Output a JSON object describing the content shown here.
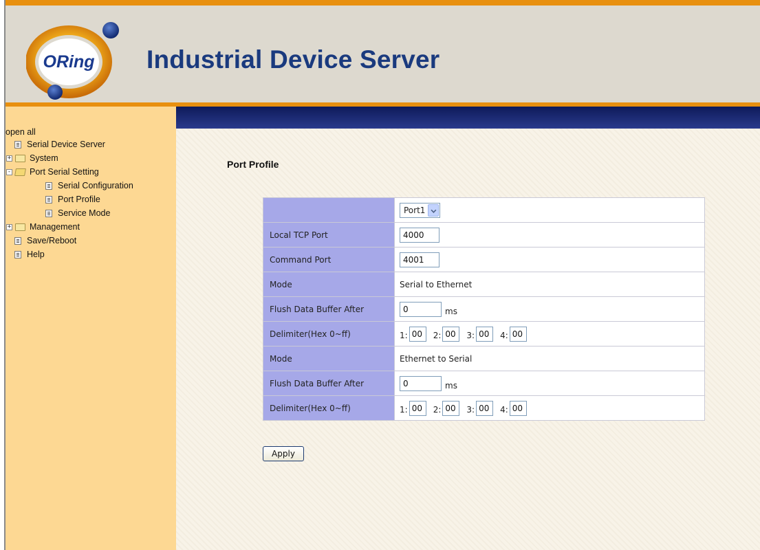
{
  "header": {
    "logo_text": "ORing",
    "title": "Industrial Device Server"
  },
  "sidebar": {
    "open_all": "open all",
    "items": [
      {
        "label": "Serial Device Server",
        "icon": "document-icon"
      },
      {
        "label": "System",
        "icon": "folder-icon",
        "toggle": "+"
      },
      {
        "label": "Port Serial Setting",
        "icon": "folder-open-icon",
        "toggle": "-"
      },
      {
        "label": "Serial Configuration",
        "icon": "document-icon"
      },
      {
        "label": "Port Profile",
        "icon": "document-icon"
      },
      {
        "label": "Service Mode",
        "icon": "document-icon"
      },
      {
        "label": "Management",
        "icon": "folder-icon",
        "toggle": "+"
      },
      {
        "label": "Save/Reboot",
        "icon": "document-icon"
      },
      {
        "label": "Help",
        "icon": "document-icon"
      }
    ]
  },
  "main": {
    "title": "Port Profile",
    "port_select": {
      "selected": "Port1"
    },
    "rows": {
      "local_tcp_port": {
        "label": "Local TCP Port",
        "value": "4000"
      },
      "command_port": {
        "label": "Command Port",
        "value": "4001"
      },
      "mode1": {
        "label": "Mode",
        "value": "Serial to Ethernet"
      },
      "flush1": {
        "label": "Flush Data Buffer After",
        "value": "0",
        "unit": "ms"
      },
      "delim1": {
        "label": "Delimiter(Hex 0~ff)",
        "l1": "1:",
        "l2": "2:",
        "l3": "3:",
        "l4": "4:",
        "v1": "00",
        "v2": "00",
        "v3": "00",
        "v4": "00"
      },
      "mode2": {
        "label": "Mode",
        "value": "Ethernet to Serial"
      },
      "flush2": {
        "label": "Flush Data Buffer After",
        "value": "0",
        "unit": "ms"
      },
      "delim2": {
        "label": "Delimiter(Hex 0~ff)",
        "l1": "1:",
        "l2": "2:",
        "l3": "3:",
        "l4": "4:",
        "v1": "00",
        "v2": "00",
        "v3": "00",
        "v4": "00"
      }
    },
    "apply_label": "Apply"
  },
  "colors": {
    "header_bg": "#ddd9cf",
    "header_accent": "#e8900f",
    "title_blue": "#1a3a7e",
    "sidebar_bg": "#fdd893",
    "nav_bar": "#1a2a7a",
    "label_cell_bg": "#a6a8e8",
    "content_bg": "#f8f3e8"
  }
}
